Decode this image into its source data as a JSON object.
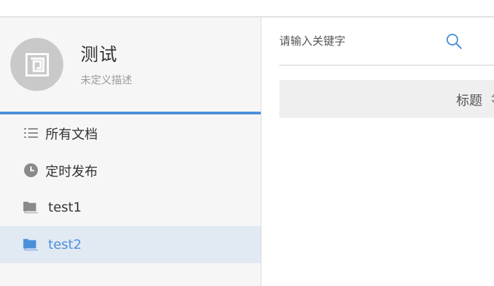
{
  "profile": {
    "name": "测试",
    "description": "未定义描述"
  },
  "nav": {
    "items": [
      {
        "label": "所有文档",
        "icon": "list-icon",
        "active": false
      },
      {
        "label": "定时发布",
        "icon": "clock-icon",
        "active": false
      },
      {
        "label": "test1",
        "icon": "folder-icon",
        "active": false
      },
      {
        "label": "test2",
        "icon": "folder-icon",
        "active": true
      }
    ]
  },
  "search": {
    "placeholder": "请输入关键字",
    "value": "",
    "icon": "search-icon"
  },
  "table": {
    "columns": [
      "标题"
    ],
    "sort_icon": "sort-icon"
  },
  "colors": {
    "accent": "#4a90d9",
    "sidebar_bg": "#f6f6f6",
    "active_bg": "#e1e9f3",
    "avatar_bg": "#c9c9c9",
    "icon_gray": "#8a8a8a",
    "table_header_bg": "#efefef"
  }
}
